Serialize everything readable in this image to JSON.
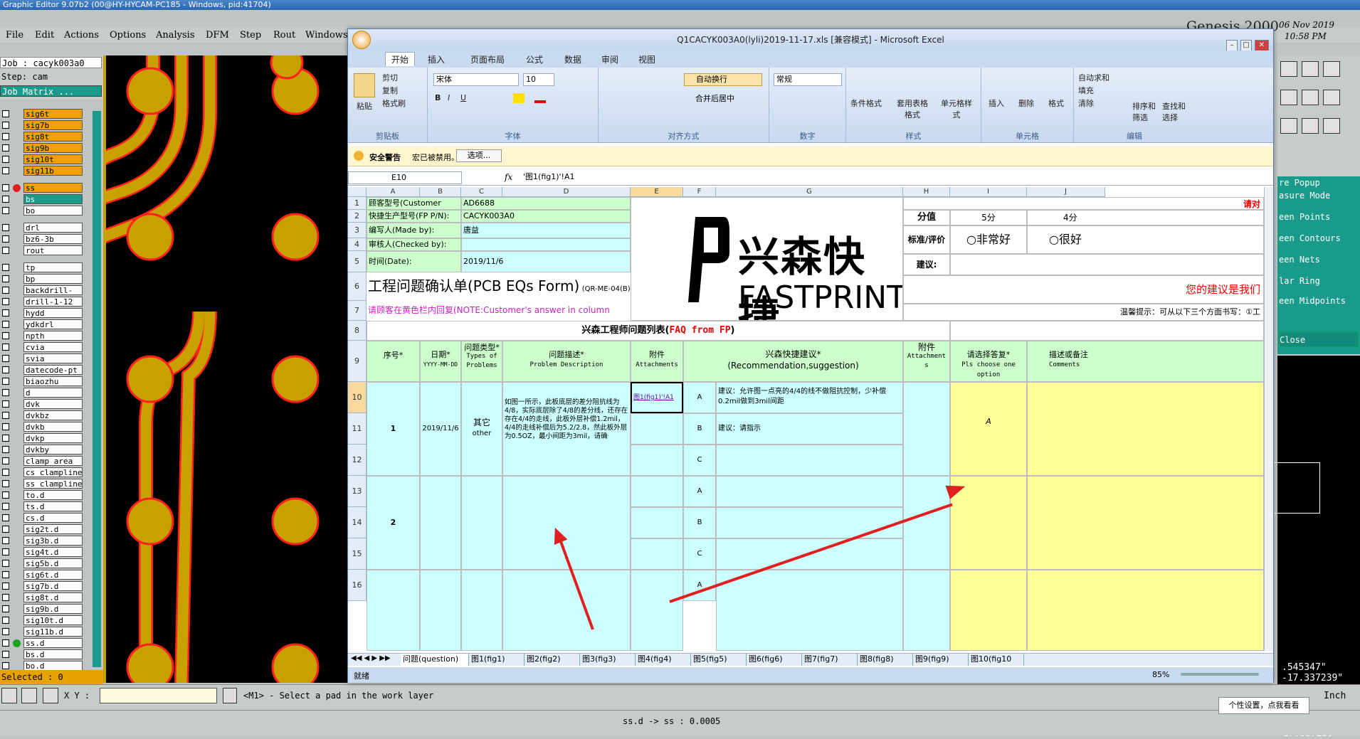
{
  "genesis": {
    "title": "Graphic Editor 9.07b2 (00@HY-HYCAM-PC185 - Windows, pid:41704)",
    "menu": [
      "File",
      "Edit",
      "Actions",
      "Options",
      "Analysis",
      "DFM",
      "Step",
      "Rout",
      "Windows"
    ],
    "job": "Job : cacyk003a0",
    "step": "Step: cam",
    "job_matrix": "Job Matrix ...",
    "layers": [
      "sig6t",
      "sig7b",
      "sig8t",
      "sig9b",
      "sig10t",
      "sig11b",
      "ss",
      "bs",
      "bo",
      "drl",
      "bz6-3b",
      "rout",
      "tp",
      "bp",
      "backdrill-",
      "drill-1-12",
      "hydd",
      "ydkdrl",
      "npth",
      "cvia",
      "svia",
      "datecode-pt",
      "biaozhu",
      "d",
      "dvk",
      "dvkbz",
      "dvkb",
      "dvkp",
      "dvkby",
      "clamp_area",
      "cs_clampline",
      "ss_clampline",
      "to.d",
      "ts.d",
      "cs.d",
      "sig2t.d",
      "sig3b.d",
      "sig4t.d",
      "sig5b.d",
      "sig6t.d",
      "sig7b.d",
      "sig8t.d",
      "sig9b.d",
      "sig10t.d",
      "sig11b.d",
      "ss.d",
      "bs.d",
      "bo.d"
    ],
    "selected": "Selected : 0",
    "xy_label": "X Y :",
    "prompt": "<M1> - Select a pad in the work layer",
    "status": "ss.d -> ss : 0.0005",
    "brand": "Genesis 2000",
    "date": "06 Nov 2019",
    "time": "10:58 PM",
    "units": "Inch",
    "coords": [
      ".545347\"",
      "-17.337239\""
    ],
    "popup_items": [
      "re Popup",
      "asure Mode",
      "een Points",
      "een Contours",
      "een Nets",
      "lar Ring",
      "een Midpoints",
      "Close"
    ],
    "tooltip": "个性设置，点我看看"
  },
  "excel": {
    "title": "Q1CACYK003A0(lyli)2019-11-17.xls  [兼容模式] - Microsoft Excel",
    "tabs": [
      "开始",
      "插入",
      "页面布局",
      "公式",
      "数据",
      "审阅",
      "视图"
    ],
    "groups": [
      "剪贴板",
      "字体",
      "对齐方式",
      "数字",
      "样式",
      "单元格",
      "编辑"
    ],
    "clip": [
      "粘贴",
      "剪切",
      "复制",
      "格式刷"
    ],
    "font_name": "宋体",
    "font_size": "10",
    "wrap": "自动换行",
    "merge": "合并后居中",
    "numfmt": "常规",
    "style_btns": [
      "条件格式",
      "套用表格格式",
      "单元格样式"
    ],
    "cell_btns": [
      "插入",
      "删除",
      "格式"
    ],
    "edit_btns": [
      "自动求和",
      "填充",
      "清除",
      "排序和筛选",
      "查找和选择"
    ],
    "security": "安全警告",
    "security_msg": "宏已被禁用。",
    "options": "选项...",
    "namebox": "E10",
    "formula": "'图1(fig1)'!A1",
    "cols": [
      "A",
      "B",
      "C",
      "D",
      "E",
      "F",
      "G",
      "H",
      "I",
      "J"
    ],
    "rows": [
      "1",
      "2",
      "3",
      "4",
      "5",
      "6",
      "7",
      "8",
      "9",
      "10",
      "11",
      "12",
      "13",
      "14",
      "15",
      "16"
    ],
    "form": {
      "cust_pn_label": "顾客型号(Customer P/N):",
      "cust_pn": "AD6688",
      "fp_pn_label": "快捷生产型号(FP P/N):",
      "fp_pn": "CACYK003A0",
      "made_by_label": "编写人(Made by):",
      "made_by": "唐益",
      "checked_label": "审核人(Checked by):",
      "date_label": "时间(Date):",
      "date": "2019/11/6",
      "form_title": "工程问题确认单(PCB EQs Form)",
      "form_code": "(QR-ME-04(B)",
      "yellow_note": "请顾客在黄色栏内回复(NOTE:Customer's answer in column yellow area)",
      "logo_cn": "兴森快捷",
      "logo_en": "FASTPRINT",
      "faq_title": "兴森工程师问题列表(",
      "faq_red": "FAQ from FP",
      "faq_close": ")",
      "score_label": "分值",
      "score5": "5分",
      "score4": "4分",
      "eval_label": "标准/评价",
      "very_good": "非常好",
      "good": "很好",
      "suggest_label": "建议:",
      "red_top": "请对",
      "red_mid": "您的建议是我们",
      "hint": "温馨提示：可从以下三个方面书写：①工"
    },
    "headers": {
      "seq": "序号*",
      "date": "日期*",
      "date_fmt": "YYYY-MM-DD",
      "type": "问题类型*",
      "type_en": "Types of Problems",
      "desc": "问题描述*",
      "desc_en": "Problem Description",
      "attach": "附件",
      "attach_en": "Attachments",
      "rec": "兴森快捷建议*",
      "rec_en": "(Recommendation,suggestion)",
      "attach2": "附件",
      "attach2_en": "Attachment s",
      "reply": "请选择答复*",
      "reply_en": "Pls choose one option",
      "remark": "描述或备注",
      "remark_en": "Comments"
    },
    "row1": {
      "seq": "1",
      "date": "2019/11/6",
      "type": "其它",
      "type_en": "other",
      "desc": "如图一所示，此板底层的差分阻抗线为4/8，实际底层除了4/8的差分线，还存在存在4/4的走线，此板外层补偿1.2mil，4/4的走线补偿后为5.2/2.8，然此板外层为0.5OZ，最小间距为3mil，请确",
      "link": "图1(fig1)'!A1",
      "optA": "A",
      "optB": "B",
      "optC": "C",
      "recA": "建议：允许图一点亮的4/4的线不做阻抗控制，少补偿0.2mil做到3mil间距",
      "recB": "建议：请指示",
      "reply": "A"
    },
    "row2": {
      "seq": "2",
      "optA": "A",
      "optB": "B",
      "optC": "C",
      "optA2": "A"
    },
    "sheet_tabs": [
      "问题(question)",
      "图1(fig1)",
      "图2(fig2)",
      "图3(fig3)",
      "图4(fig4)",
      "图5(fig5)",
      "图6(fig6)",
      "图7(fig7)",
      "图8(fig8)",
      "图9(fig9)",
      "图10(fig10"
    ],
    "ready": "就绪",
    "zoom": "85%"
  },
  "colors": {
    "accent_red": "#e02020",
    "pad_gold": "#c8a000",
    "layer_orange": "#f0a000"
  }
}
